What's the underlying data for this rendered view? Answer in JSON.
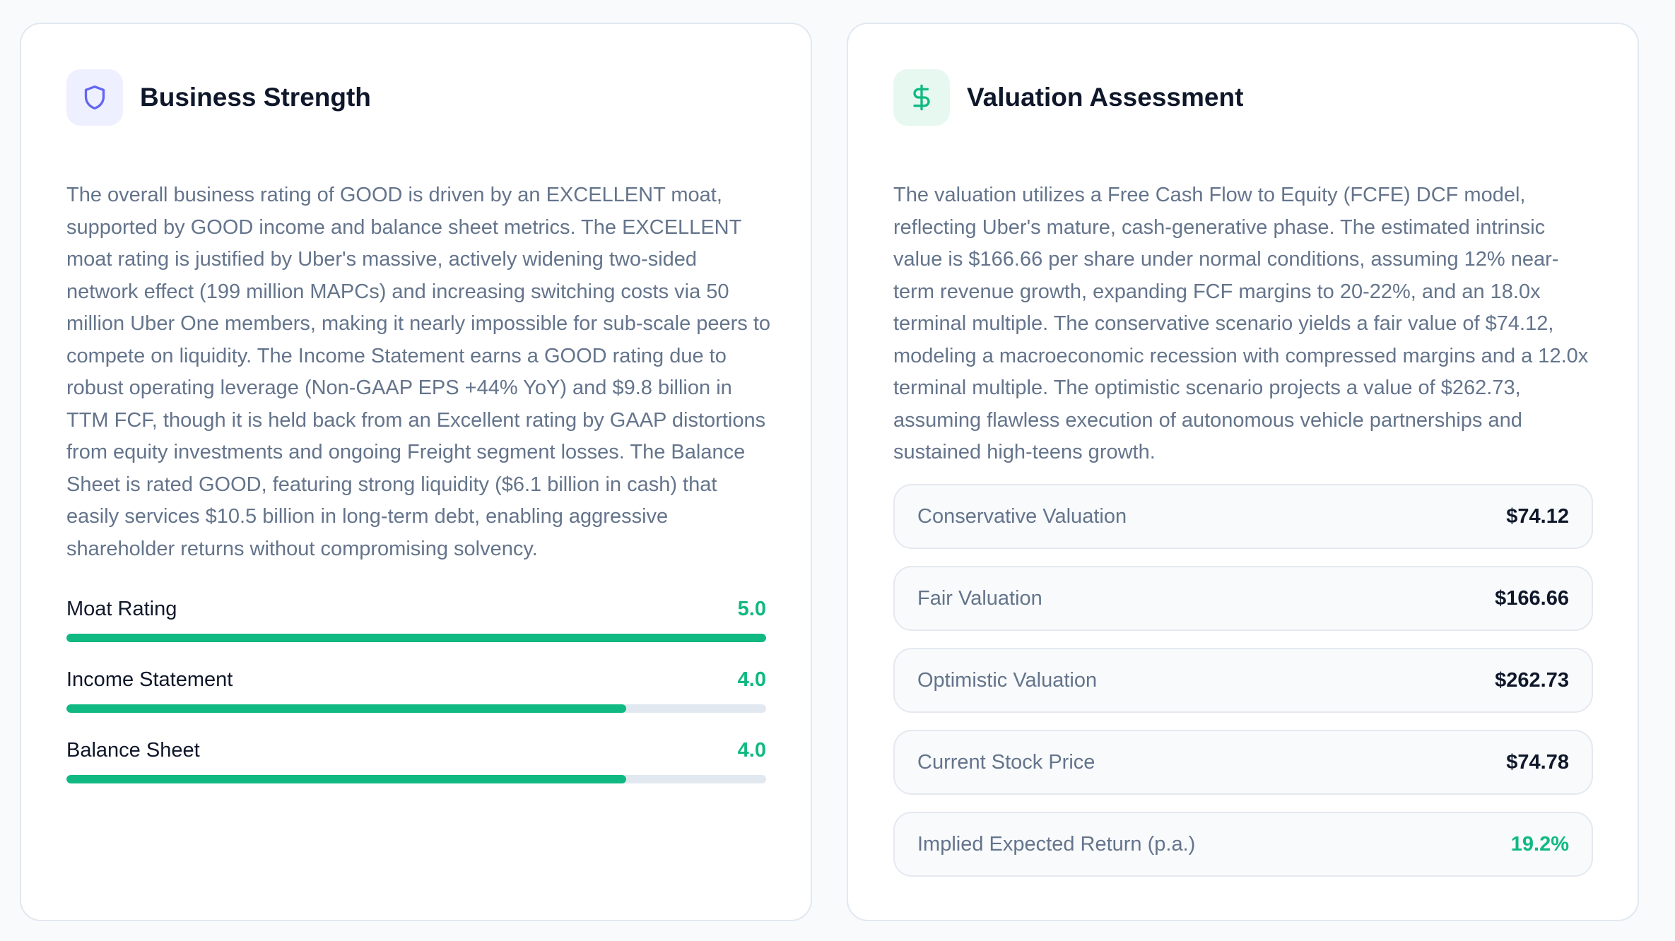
{
  "business": {
    "title": "Business Strength",
    "icon": "shield-icon",
    "description": "The overall business rating of GOOD is driven by an EXCELLENT moat, supported by GOOD income and balance sheet metrics. The EXCELLENT moat rating is justified by Uber's massive, actively widening two-sided network effect (199 million MAPCs) and increasing switching costs via 50 million Uber One members, making it nearly impossible for sub-scale peers to compete on liquidity. The Income Statement earns a GOOD rating due to robust operating leverage (Non-GAAP EPS +44% YoY) and $9.8 billion in TTM FCF, though it is held back from an Excellent rating by GAAP distortions from equity investments and ongoing Freight segment losses. The Balance Sheet is rated GOOD, featuring strong liquidity ($6.1 billion in cash) that easily services $10.5 billion in long-term debt, enabling aggressive shareholder returns without compromising solvency.",
    "ratings": [
      {
        "label": "Moat Rating",
        "value": "5.0",
        "score": 5.0,
        "max": 5
      },
      {
        "label": "Income Statement",
        "value": "4.0",
        "score": 4.0,
        "max": 5
      },
      {
        "label": "Balance Sheet",
        "value": "4.0",
        "score": 4.0,
        "max": 5
      }
    ]
  },
  "valuation": {
    "title": "Valuation Assessment",
    "icon": "dollar-icon",
    "description": "The valuation utilizes a Free Cash Flow to Equity (FCFE) DCF model, reflecting Uber's mature, cash-generative phase. The estimated intrinsic value is $166.66 per share under normal conditions, assuming 12% near-term revenue growth, expanding FCF margins to 20-22%, and an 18.0x terminal multiple. The conservative scenario yields a fair value of $74.12, modeling a macroeconomic recession with compressed margins and a 12.0x terminal multiple. The optimistic scenario projects a value of $262.73, assuming flawless execution of autonomous vehicle partnerships and sustained high-teens growth.",
    "rows": [
      {
        "label": "Conservative Valuation",
        "value": "$74.12"
      },
      {
        "label": "Fair Valuation",
        "value": "$166.66"
      },
      {
        "label": "Optimistic Valuation",
        "value": "$262.73"
      },
      {
        "label": "Current Stock Price",
        "value": "$74.78"
      },
      {
        "label": "Implied Expected Return (p.a.)",
        "value": "19.2%"
      }
    ]
  },
  "colors": {
    "accent_green": "#10b981",
    "accent_violet": "#6366f1"
  }
}
